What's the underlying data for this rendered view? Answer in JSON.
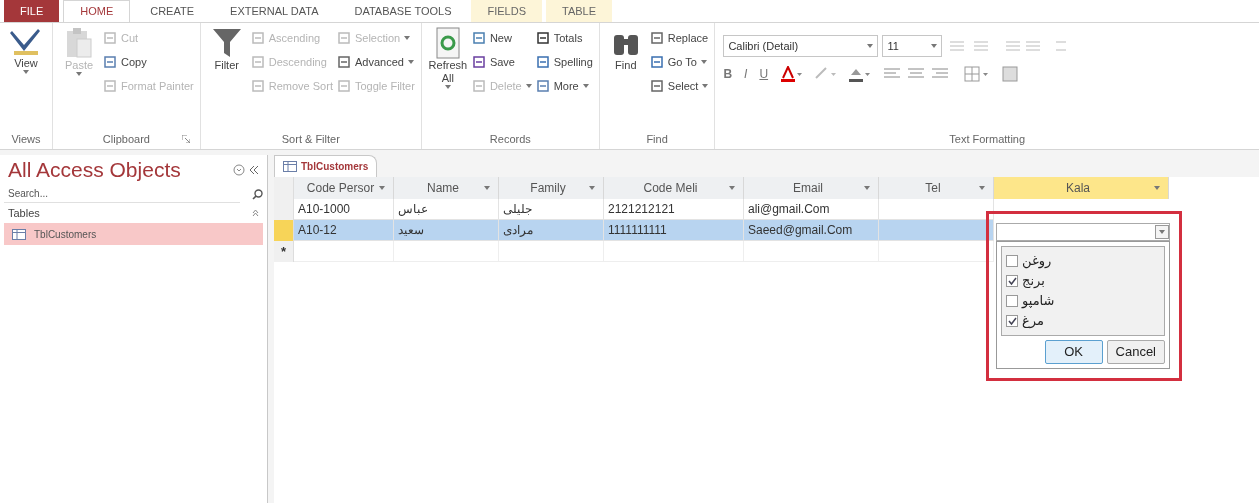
{
  "ribbon": {
    "tabs": [
      {
        "label": "FILE",
        "kind": "file",
        "selected": false
      },
      {
        "label": "HOME",
        "kind": "normal",
        "selected": true
      },
      {
        "label": "CREATE",
        "kind": "normal",
        "selected": false
      },
      {
        "label": "EXTERNAL DATA",
        "kind": "normal",
        "selected": false
      },
      {
        "label": "DATABASE TOOLS",
        "kind": "normal",
        "selected": false
      },
      {
        "label": "FIELDS",
        "kind": "contextual",
        "selected": false
      },
      {
        "label": "TABLE",
        "kind": "contextual",
        "selected": false
      }
    ],
    "groups": [
      {
        "title": "Views",
        "launcher": false,
        "columns": [
          [
            {
              "kind": "large",
              "label": "View",
              "disabled": false,
              "dropdown": true
            }
          ]
        ]
      },
      {
        "title": "Clipboard",
        "launcher": true,
        "columns": [
          [
            {
              "kind": "large",
              "label": "Paste",
              "disabled": true,
              "dropdown": true
            }
          ],
          [
            {
              "kind": "small",
              "label": "Cut",
              "disabled": true,
              "dropdown": false
            },
            {
              "kind": "small",
              "label": "Copy",
              "disabled": false,
              "dropdown": false
            },
            {
              "kind": "small",
              "label": "Format Painter",
              "disabled": true,
              "dropdown": false
            }
          ]
        ]
      },
      {
        "title": "Sort & Filter",
        "launcher": false,
        "columns": [
          [
            {
              "kind": "large",
              "label": "Filter",
              "disabled": false,
              "dropdown": false
            }
          ],
          [
            {
              "kind": "small",
              "label": "Ascending",
              "disabled": true,
              "dropdown": false
            },
            {
              "kind": "small",
              "label": "Descending",
              "disabled": true,
              "dropdown": false
            },
            {
              "kind": "small",
              "label": "Remove Sort",
              "disabled": true,
              "dropdown": false
            }
          ],
          [
            {
              "kind": "small",
              "label": "Selection",
              "disabled": true,
              "dropdown": true
            },
            {
              "kind": "small",
              "label": "Advanced",
              "disabled": false,
              "dropdown": true
            },
            {
              "kind": "small",
              "label": "Toggle Filter",
              "disabled": true,
              "dropdown": false
            }
          ]
        ]
      },
      {
        "title": "Records",
        "launcher": false,
        "columns": [
          [
            {
              "kind": "large",
              "label": "Refresh All",
              "disabled": false,
              "dropdown": true
            }
          ],
          [
            {
              "kind": "small",
              "label": "New",
              "disabled": false,
              "dropdown": false
            },
            {
              "kind": "small",
              "label": "Save",
              "disabled": false,
              "dropdown": false
            },
            {
              "kind": "small",
              "label": "Delete",
              "disabled": true,
              "dropdown": true
            }
          ],
          [
            {
              "kind": "small",
              "label": "Totals",
              "disabled": false,
              "dropdown": false
            },
            {
              "kind": "small",
              "label": "Spelling",
              "disabled": false,
              "dropdown": false
            },
            {
              "kind": "small",
              "label": "More",
              "disabled": false,
              "dropdown": true
            }
          ]
        ]
      },
      {
        "title": "Find",
        "launcher": false,
        "columns": [
          [
            {
              "kind": "large",
              "label": "Find",
              "disabled": false,
              "dropdown": false
            }
          ],
          [
            {
              "kind": "small",
              "label": "Replace",
              "disabled": false,
              "dropdown": false
            },
            {
              "kind": "small",
              "label": "Go To",
              "disabled": false,
              "dropdown": true
            },
            {
              "kind": "small",
              "label": "Select",
              "disabled": false,
              "dropdown": true
            }
          ]
        ]
      }
    ],
    "text_formatting": {
      "title": "Text Formatting",
      "font": "Calibri (Detail)",
      "size": "11",
      "bold": "B",
      "italic": "I",
      "underline": "U"
    }
  },
  "nav_pane": {
    "title": "All Access Objects",
    "search": {
      "placeholder": "Search..."
    },
    "section": "Tables",
    "items": [
      {
        "label": "TblCustomers",
        "selected": true
      }
    ]
  },
  "document_tab": {
    "label": "TblCustomers"
  },
  "table": {
    "columns": [
      {
        "label": "Code Persor",
        "selected": false
      },
      {
        "label": "Name",
        "selected": false
      },
      {
        "label": "Family",
        "selected": false
      },
      {
        "label": "Code Meli",
        "selected": false
      },
      {
        "label": "Email",
        "selected": false
      },
      {
        "label": "Tel",
        "selected": false
      },
      {
        "label": "Kala",
        "selected": true
      }
    ],
    "rows": [
      {
        "selected": false,
        "cells": [
          "A10-1000",
          "عباس",
          "جلیلی",
          "2121212121",
          "ali@gmail.Com",
          ""
        ]
      },
      {
        "selected": true,
        "cells": [
          "A10-12",
          "سعید",
          "مرادی",
          "1111111111",
          "Saeed@gmail.Com",
          ""
        ]
      }
    ],
    "new_row_marker": "*"
  },
  "kala_dropdown": {
    "options": [
      {
        "label": "روغن",
        "checked": false
      },
      {
        "label": "برنج",
        "checked": true
      },
      {
        "label": "شامپو",
        "checked": false
      },
      {
        "label": "مرغ",
        "checked": true
      }
    ],
    "buttons": [
      "OK",
      "Cancel"
    ]
  }
}
